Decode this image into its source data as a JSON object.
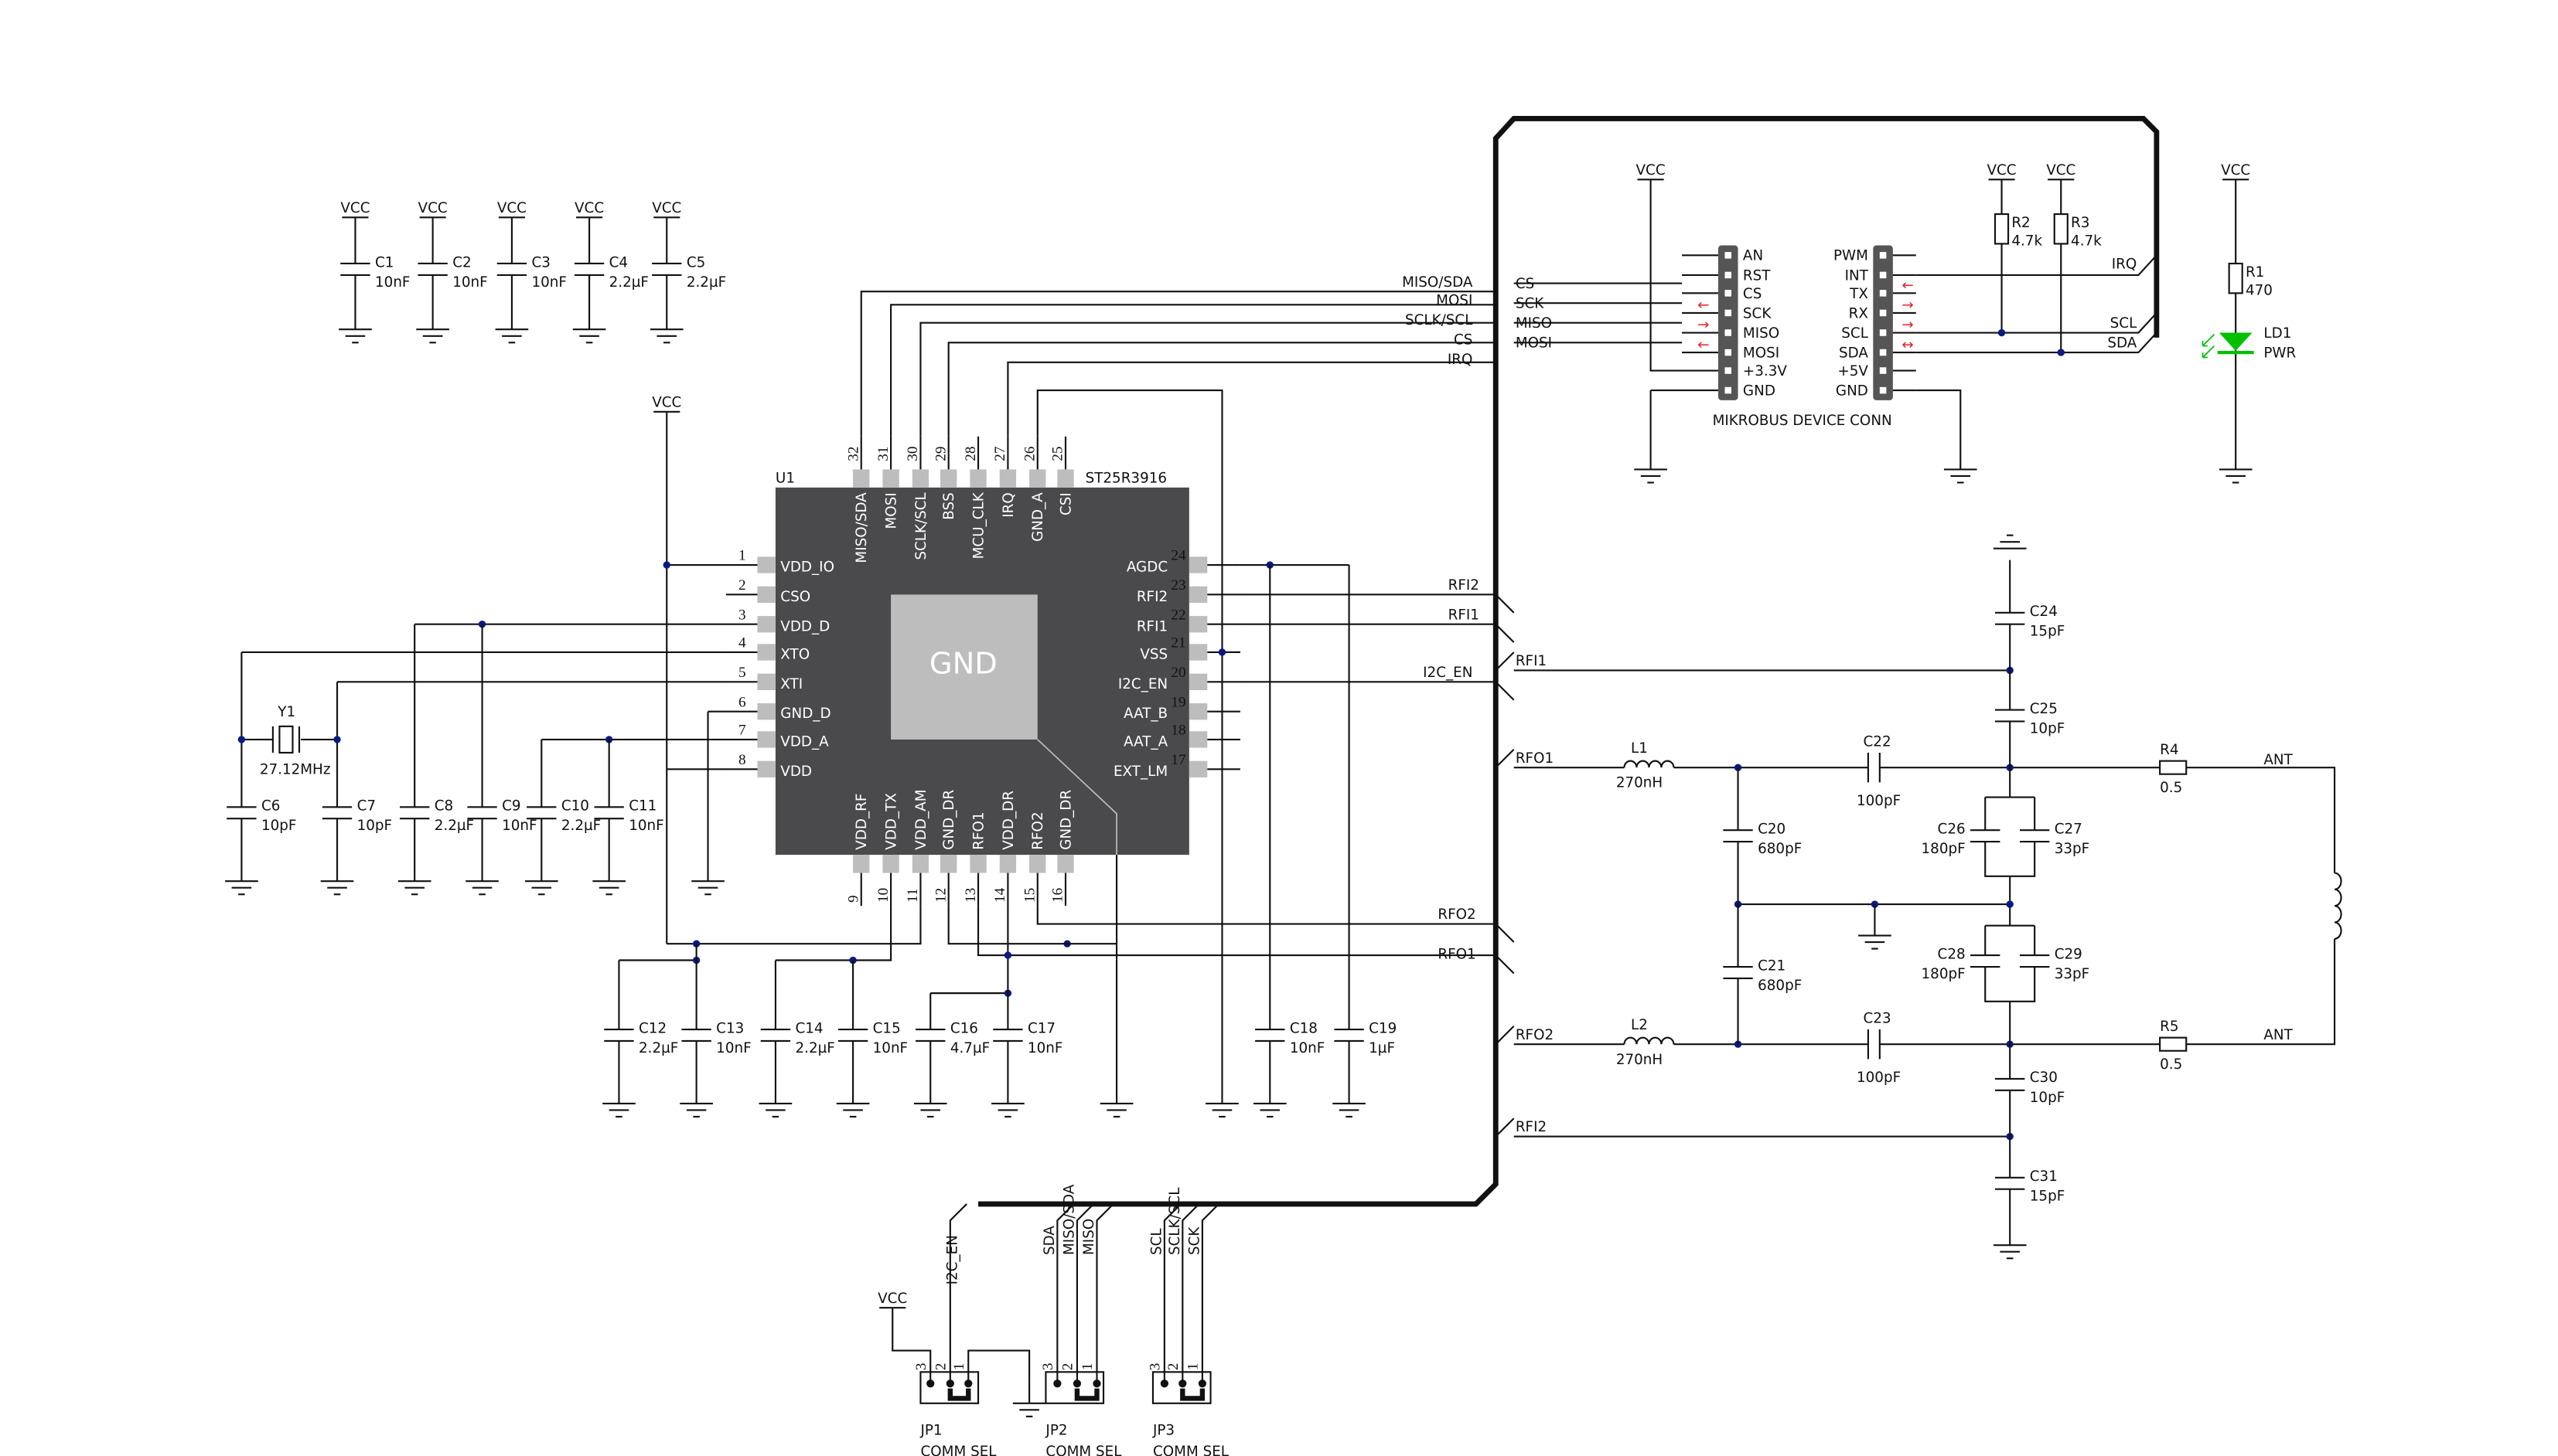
{
  "power": {
    "vcc": "VCC"
  },
  "u1": {
    "ref": "U1",
    "part": "ST25R3916",
    "pad": "GND",
    "left": [
      {
        "n": "1",
        "name": "VDD_IO"
      },
      {
        "n": "2",
        "name": "CSO"
      },
      {
        "n": "3",
        "name": "VDD_D"
      },
      {
        "n": "4",
        "name": "XTO"
      },
      {
        "n": "5",
        "name": "XTI"
      },
      {
        "n": "6",
        "name": "GND_D"
      },
      {
        "n": "7",
        "name": "VDD_A"
      },
      {
        "n": "8",
        "name": "VDD"
      }
    ],
    "right": [
      {
        "n": "24",
        "name": "AGDC"
      },
      {
        "n": "23",
        "name": "RFI2"
      },
      {
        "n": "22",
        "name": "RFI1"
      },
      {
        "n": "21",
        "name": "VSS"
      },
      {
        "n": "20",
        "name": "I2C_EN"
      },
      {
        "n": "19",
        "name": "AAT_B"
      },
      {
        "n": "18",
        "name": "AAT_A"
      },
      {
        "n": "17",
        "name": "EXT_LM"
      }
    ],
    "top": [
      {
        "n": "32",
        "name": "MISO/SDA"
      },
      {
        "n": "31",
        "name": "MOSI"
      },
      {
        "n": "30",
        "name": "SCLK/SCL"
      },
      {
        "n": "29",
        "name": "BSS"
      },
      {
        "n": "28",
        "name": "MCU_CLK"
      },
      {
        "n": "27",
        "name": "IRQ"
      },
      {
        "n": "26",
        "name": "GND_A"
      },
      {
        "n": "25",
        "name": "CSI"
      }
    ],
    "bottom": [
      {
        "n": "9",
        "name": "VDD_RF"
      },
      {
        "n": "10",
        "name": "VDD_TX"
      },
      {
        "n": "11",
        "name": "VDD_AM"
      },
      {
        "n": "12",
        "name": "GND_DR"
      },
      {
        "n": "13",
        "name": "RFO1"
      },
      {
        "n": "14",
        "name": "VDD_DR"
      },
      {
        "n": "15",
        "name": "RFO2"
      },
      {
        "n": "16",
        "name": "GND_DR"
      }
    ]
  },
  "capacitors": [
    {
      "ref": "C1",
      "value": "10nF"
    },
    {
      "ref": "C2",
      "value": "10nF"
    },
    {
      "ref": "C3",
      "value": "10nF"
    },
    {
      "ref": "C4",
      "value": "2.2µF"
    },
    {
      "ref": "C5",
      "value": "2.2µF"
    },
    {
      "ref": "C6",
      "value": "10pF"
    },
    {
      "ref": "C7",
      "value": "10pF"
    },
    {
      "ref": "C8",
      "value": "2.2µF"
    },
    {
      "ref": "C9",
      "value": "10nF"
    },
    {
      "ref": "C10",
      "value": "2.2µF"
    },
    {
      "ref": "C11",
      "value": "10nF"
    },
    {
      "ref": "C12",
      "value": "2.2µF"
    },
    {
      "ref": "C13",
      "value": "10nF"
    },
    {
      "ref": "C14",
      "value": "2.2µF"
    },
    {
      "ref": "C15",
      "value": "10nF"
    },
    {
      "ref": "C16",
      "value": "4.7µF"
    },
    {
      "ref": "C17",
      "value": "10nF"
    },
    {
      "ref": "C18",
      "value": "10nF"
    },
    {
      "ref": "C19",
      "value": "1µF"
    },
    {
      "ref": "C20",
      "value": "680pF"
    },
    {
      "ref": "C21",
      "value": "680pF"
    },
    {
      "ref": "C22",
      "value": "100pF"
    },
    {
      "ref": "C23",
      "value": "100pF"
    },
    {
      "ref": "C24",
      "value": "15pF"
    },
    {
      "ref": "C25",
      "value": "10pF"
    },
    {
      "ref": "C26",
      "value": "180pF"
    },
    {
      "ref": "C27",
      "value": "33pF"
    },
    {
      "ref": "C28",
      "value": "180pF"
    },
    {
      "ref": "C29",
      "value": "33pF"
    },
    {
      "ref": "C30",
      "value": "10pF"
    },
    {
      "ref": "C31",
      "value": "15pF"
    }
  ],
  "resistors": [
    {
      "ref": "R1",
      "value": "470"
    },
    {
      "ref": "R2",
      "value": "4.7k"
    },
    {
      "ref": "R3",
      "value": "4.7k"
    },
    {
      "ref": "R4",
      "value": "0.5"
    },
    {
      "ref": "R5",
      "value": "0.5"
    }
  ],
  "inductors": [
    {
      "ref": "L1",
      "value": "270nH"
    },
    {
      "ref": "L2",
      "value": "270nH"
    }
  ],
  "crystal": {
    "ref": "Y1",
    "value": "27.12MHz"
  },
  "led": {
    "ref": "LD1",
    "value": "PWR",
    "color": "#00c000"
  },
  "arrow_color": "#e8202a",
  "mikrobus": {
    "title": "MIKROBUS DEVICE CONN",
    "left": [
      "AN",
      "RST",
      "CS",
      "SCK",
      "MISO",
      "MOSI",
      "+3.3V",
      "GND"
    ],
    "right": [
      "PWM",
      "INT",
      "TX",
      "RX",
      "SCL",
      "SDA",
      "+5V",
      "GND"
    ],
    "left_arrows": [
      "←",
      "→",
      "←"
    ],
    "right_arrows": [
      "←",
      "→",
      "→",
      "↔"
    ]
  },
  "net_labels": {
    "u1_side": [
      "MISO/SDA",
      "MOSI",
      "SCLK/SCL",
      "CS",
      "IRQ",
      "RFI2",
      "RFI1",
      "I2C_EN",
      "RFO2",
      "RFO1"
    ],
    "bus_side": [
      "CS",
      "SCK",
      "MISO",
      "MOSI",
      "IRQ",
      "SCL",
      "SDA"
    ],
    "rf_side": [
      "RFI1",
      "RFO1",
      "RFO2",
      "RFI2",
      "ANT",
      "ANT"
    ]
  },
  "jumpers": [
    {
      "ref": "JP1",
      "value": "COMM SEL",
      "pins": [
        "3",
        "2",
        "1"
      ],
      "nets": [
        "I2C_EN"
      ]
    },
    {
      "ref": "JP2",
      "value": "COMM SEL",
      "pins": [
        "3",
        "2",
        "1"
      ],
      "nets": [
        "SDA",
        "MISO/SDA",
        "MISO"
      ]
    },
    {
      "ref": "JP3",
      "value": "COMM SEL",
      "pins": [
        "3",
        "2",
        "1"
      ],
      "nets": [
        "SCL",
        "SCLK/SCL",
        "SCK"
      ]
    }
  ]
}
